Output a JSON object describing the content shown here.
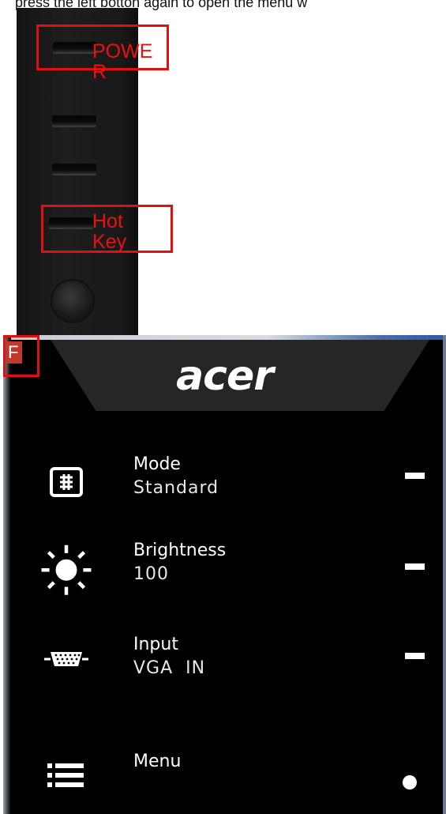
{
  "caption": "press the left botton again to open the menu w",
  "annotations": {
    "power_label": "POWE\nR",
    "hotkey_label": "Hot\nKey",
    "box_color": "#e01010"
  },
  "osd": {
    "logo": "acer",
    "indicator": "F",
    "items": [
      {
        "icon": "mode-icon",
        "label": "Mode",
        "value": "Standard",
        "control": "dash"
      },
      {
        "icon": "brightness-icon",
        "label": "Brightness",
        "value": "100",
        "control": "dash"
      },
      {
        "icon": "vga-input-icon",
        "label": "Input",
        "value": "VGA  IN",
        "control": "dash"
      },
      {
        "icon": "menu-icon",
        "label": "Menu",
        "value": "",
        "control": "dot"
      }
    ]
  }
}
